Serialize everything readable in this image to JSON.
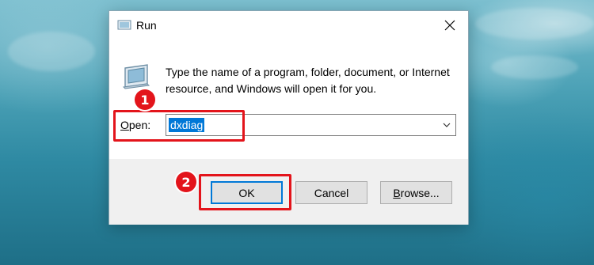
{
  "dialog": {
    "title": "Run",
    "description": "Type the name of a program, folder, document, or Internet resource, and Windows will open it for you.",
    "open_label_accel": "O",
    "open_label_rest": "pen:",
    "open_value": "dxdiag"
  },
  "buttons": {
    "ok": "OK",
    "cancel": "Cancel",
    "browse_accel": "B",
    "browse_rest": "rowse..."
  },
  "annotations": {
    "step1": "1",
    "step2": "2"
  },
  "colors": {
    "highlight": "#e3141b",
    "selection": "#0078d7",
    "accent_border": "#0078d7"
  },
  "icons": {
    "title": "run-app-icon",
    "close": "close-icon",
    "dropdown": "chevron-down-icon",
    "program": "run-program-icon"
  }
}
